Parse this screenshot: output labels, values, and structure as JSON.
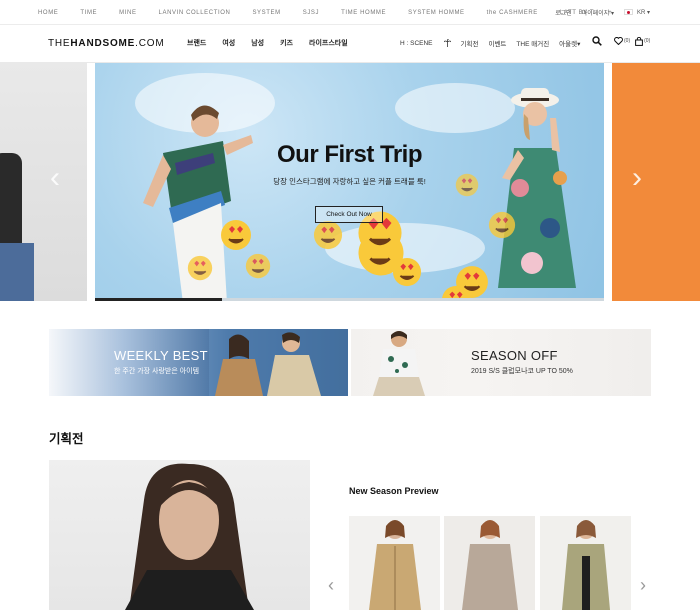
{
  "topbar": {
    "brands": [
      "HOME",
      "TIME",
      "MINE",
      "LANVIN COLLECTION",
      "SYSTEM",
      "SJSJ",
      "TIME HOMME",
      "SYSTEM HOMME",
      "the CASHMERE",
      "LATT BY T"
    ],
    "plus": "+",
    "login": "로그인",
    "mypage": "마이페이지 ▾",
    "language": "KR ▾"
  },
  "header": {
    "logo_a": "THE",
    "logo_b": "HANDSOME",
    "logo_c": ".COM",
    "gnb": [
      "브랜드",
      "여성",
      "남성",
      "키즈",
      "라이프스타일"
    ],
    "sub": [
      "H : SCENE",
      "기획전",
      "이벤트",
      "THE 매거진",
      "아울렛▾"
    ],
    "wish_count": "(0)",
    "bag_count": "(0)"
  },
  "hero": {
    "title": "Our First Trip",
    "subtitle": "당장 인스타그램에 자랑하고 싶은 커플 트래블 룩!",
    "cta": "Check Out Now",
    "progress": 0.25,
    "prev_arrow": "‹",
    "next_arrow": "›"
  },
  "promos": [
    {
      "title": "WEEKLY BEST",
      "sub": "한 주간 가장 사랑받은 아이템"
    },
    {
      "title": "SEASON OFF",
      "sub": "2019 S/S 클럽모나코 UP TO 50%"
    }
  ],
  "exhibition": {
    "heading": "기획전",
    "preview_title": "New Season Preview",
    "prev": "‹",
    "next": "›"
  },
  "colors": {
    "accent_orange": "#f28a3a",
    "sky": "#a8d2ec",
    "navy": "#2d5787"
  }
}
